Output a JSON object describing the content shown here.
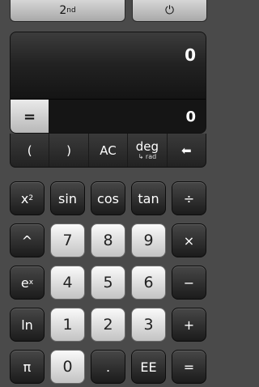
{
  "top_bar": {
    "second_label": "2",
    "second_sup": "nd",
    "power_symbol": "⏻"
  },
  "display": {
    "main_value": "0",
    "equals_label": "=",
    "result_value": "0"
  },
  "function_row": {
    "open_paren": "(",
    "close_paren": ")",
    "clear": "AC",
    "angle_mode": "deg",
    "angle_mode_sub": "↳ rad",
    "backspace": "⬅"
  },
  "keypad": {
    "x_squared_base": "x",
    "x_squared_sup": "2",
    "sin": "sin",
    "cos": "cos",
    "tan": "tan",
    "divide": "÷",
    "power": "^",
    "seven": "7",
    "eight": "8",
    "nine": "9",
    "multiply": "×",
    "exp_base": "e",
    "exp_sup": "x",
    "four": "4",
    "five": "5",
    "six": "6",
    "minus": "−",
    "ln": "ln",
    "one": "1",
    "two": "2",
    "three": "3",
    "plus": "+",
    "pi": "π",
    "zero": "0",
    "decimal": ".",
    "ee": "EE",
    "equals": "="
  }
}
